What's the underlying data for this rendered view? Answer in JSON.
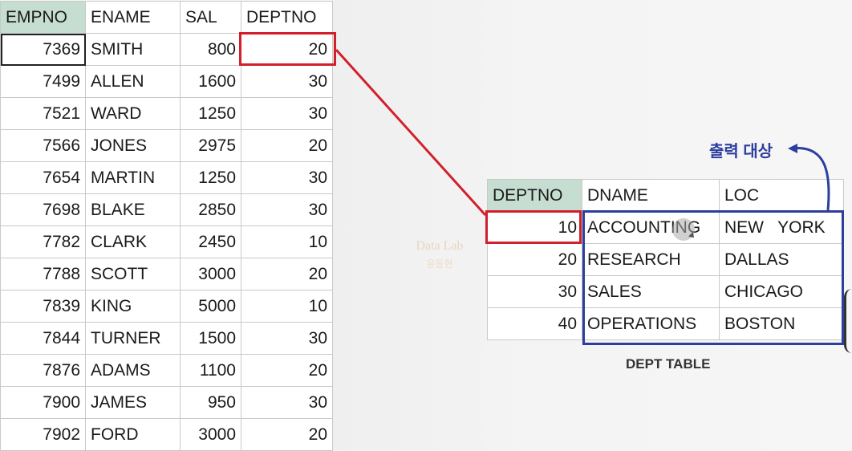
{
  "emp_table": {
    "columns": [
      "EMPNO",
      "ENAME",
      "SAL",
      "DEPTNO"
    ],
    "rows": [
      {
        "empno": "7369",
        "ename": "SMITH",
        "sal": "800",
        "deptno": "20"
      },
      {
        "empno": "7499",
        "ename": "ALLEN",
        "sal": "1600",
        "deptno": "30"
      },
      {
        "empno": "7521",
        "ename": "WARD",
        "sal": "1250",
        "deptno": "30"
      },
      {
        "empno": "7566",
        "ename": "JONES",
        "sal": "2975",
        "deptno": "20"
      },
      {
        "empno": "7654",
        "ename": "MARTIN",
        "sal": "1250",
        "deptno": "30"
      },
      {
        "empno": "7698",
        "ename": "BLAKE",
        "sal": "2850",
        "deptno": "30"
      },
      {
        "empno": "7782",
        "ename": "CLARK",
        "sal": "2450",
        "deptno": "10"
      },
      {
        "empno": "7788",
        "ename": "SCOTT",
        "sal": "3000",
        "deptno": "20"
      },
      {
        "empno": "7839",
        "ename": "KING",
        "sal": "5000",
        "deptno": "10"
      },
      {
        "empno": "7844",
        "ename": "TURNER",
        "sal": "1500",
        "deptno": "30"
      },
      {
        "empno": "7876",
        "ename": "ADAMS",
        "sal": "1100",
        "deptno": "20"
      },
      {
        "empno": "7900",
        "ename": "JAMES",
        "sal": "950",
        "deptno": "30"
      },
      {
        "empno": "7902",
        "ename": "FORD",
        "sal": "3000",
        "deptno": "20"
      }
    ]
  },
  "dept_table": {
    "columns": [
      "DEPTNO",
      "DNAME",
      "LOC"
    ],
    "rows": [
      {
        "deptno": "10",
        "dname": "ACCOUNTING",
        "loc": "NEW   YORK"
      },
      {
        "deptno": "20",
        "dname": "RESEARCH",
        "loc": "DALLAS"
      },
      {
        "deptno": "30",
        "dname": "SALES",
        "loc": "CHICAGO"
      },
      {
        "deptno": "40",
        "dname": "OPERATIONS",
        "loc": "BOSTON"
      }
    ],
    "caption": "DEPT TABLE"
  },
  "annotation": {
    "output_target": "출력 대상"
  },
  "watermark": {
    "line1": "Data Lab",
    "line2": "윤동현"
  },
  "colors": {
    "selected_header": "#c6ddd2",
    "highlight_red": "#d11f2b",
    "highlight_blue": "#2c3e9e"
  }
}
